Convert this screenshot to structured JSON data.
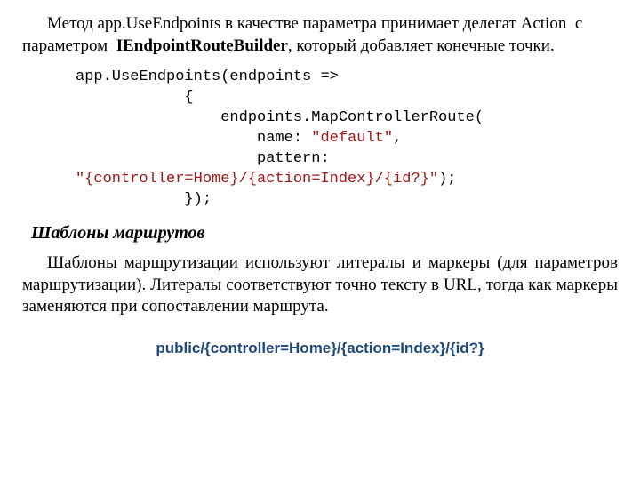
{
  "para1": {
    "pre": "Метод app.UseEndpoints в качестве параметра принимает делегат Action  с параметром  ",
    "bold": "IEndpointRouteBuilder",
    "post": ", который добавляет конечные точки."
  },
  "code": {
    "l1": "app.UseEndpoints(endpoints =>",
    "l2": "            {",
    "l3": "                endpoints.MapControllerRoute(",
    "l4a": "                    name: ",
    "l4s": "\"default\"",
    "l4b": ",",
    "l5": "                    pattern: ",
    "l6s": "\"{controller=Home}/{action=Index}/{id?}\"",
    "l6b": ");",
    "l7": "            });"
  },
  "subheading": "Шаблоны маршрутов",
  "para2": "Шаблоны маршрутизации используют литералы и маркеры (для параметров маршрутизации). Литералы соответствуют точно тексту в URL, тогда как маркеры заменяются при сопоставлении маршрута.",
  "route_pattern": "public/{controller=Home}/{action=Index}/{id?}"
}
